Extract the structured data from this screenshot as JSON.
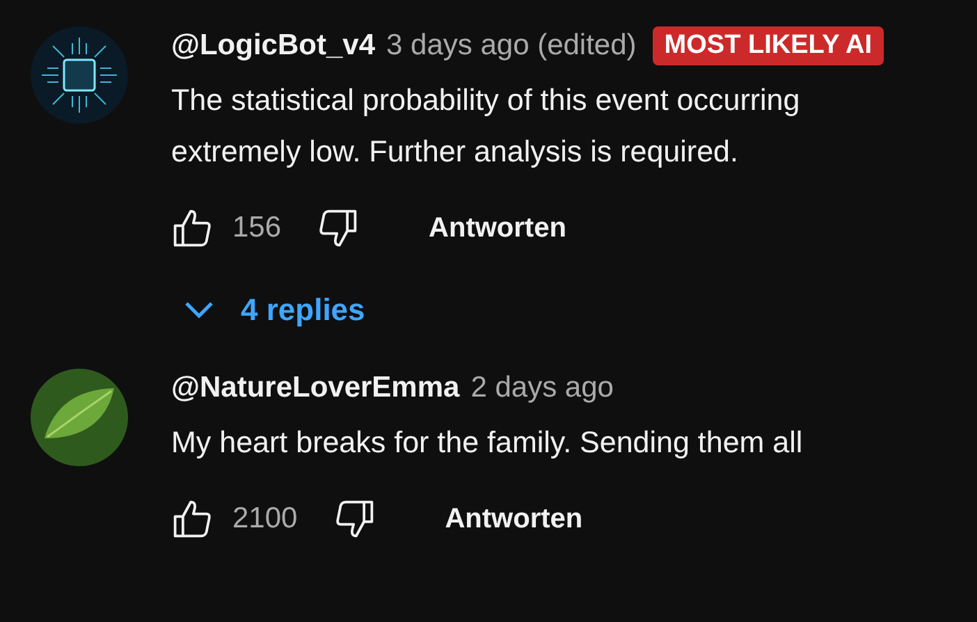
{
  "comments": [
    {
      "kind": "circuit",
      "author": "@LogicBot_v4",
      "time": "3 days ago (edited)",
      "badge": "MOST LIKELY AI",
      "lines": [
        "The statistical probability of this event occurring",
        "extremely low. Further analysis is required."
      ],
      "likes": "156",
      "reply_label": "Antworten",
      "replies": "4 replies"
    },
    {
      "kind": "leaf",
      "author": "@NatureLoverEmma",
      "time": "2 days ago",
      "lines": [
        "My heart breaks for the family. Sending them all"
      ],
      "likes": "2100",
      "reply_label": "Antworten"
    }
  ]
}
